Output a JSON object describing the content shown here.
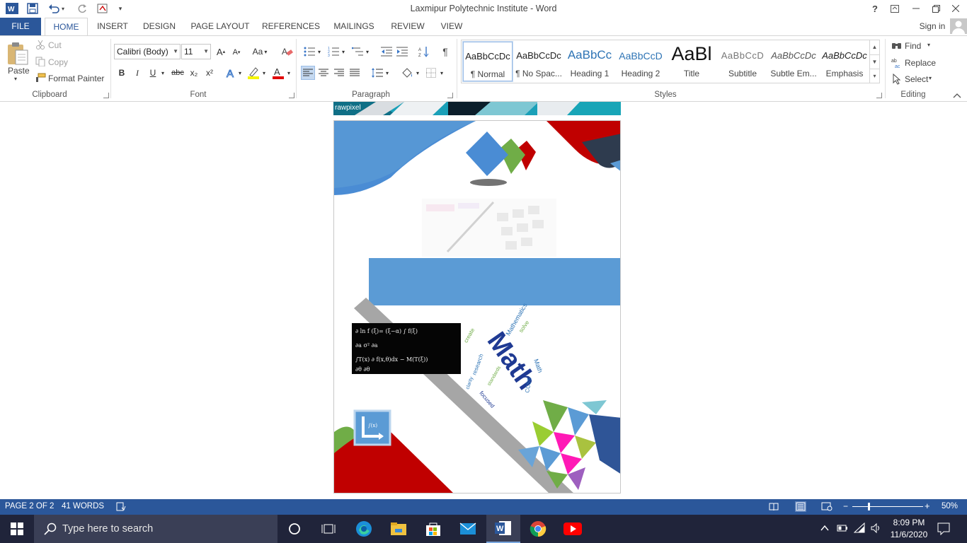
{
  "window": {
    "title": "Laxmipur Polytechnic Institute - Word"
  },
  "tabs": [
    {
      "label": "FILE"
    },
    {
      "label": "HOME"
    },
    {
      "label": "INSERT"
    },
    {
      "label": "DESIGN"
    },
    {
      "label": "PAGE LAYOUT"
    },
    {
      "label": "REFERENCES"
    },
    {
      "label": "MAILINGS"
    },
    {
      "label": "REVIEW"
    },
    {
      "label": "VIEW"
    }
  ],
  "account": {
    "signin": "Sign in"
  },
  "clipboard": {
    "paste": "Paste",
    "cut": "Cut",
    "copy": "Copy",
    "format_painter": "Format Painter",
    "label": "Clipboard"
  },
  "font": {
    "name": "Calibri (Body)",
    "size": "11",
    "label": "Font",
    "bold": "B",
    "italic": "I",
    "underline": "U",
    "strike": "abc",
    "sub": "x₂",
    "sup": "x²",
    "grow": "A",
    "shrink": "A",
    "case": "Aa"
  },
  "paragraph": {
    "label": "Paragraph"
  },
  "styles": {
    "label": "Styles",
    "items": [
      {
        "preview": "AaBbCcDc",
        "name": "¶ Normal"
      },
      {
        "preview": "AaBbCcDc",
        "name": "¶ No Spac..."
      },
      {
        "preview": "AaBbCc",
        "name": "Heading 1"
      },
      {
        "preview": "AaBbCcD",
        "name": "Heading 2"
      },
      {
        "preview": "AaBl",
        "name": "Title"
      },
      {
        "preview": "AaBbCcD",
        "name": "Subtitle"
      },
      {
        "preview": "AaBbCcDc",
        "name": "Subtle Em..."
      },
      {
        "preview": "AaBbCcDc",
        "name": "Emphasis"
      }
    ]
  },
  "editing": {
    "find": "Find",
    "replace": "Replace",
    "select": "Select",
    "label": "Editing"
  },
  "document": {
    "page1_watermark": "rawpixel",
    "wordcloud_main": "Math",
    "wordcloud_words": [
      "create",
      "solve",
      "Mathematics",
      "research",
      "focused",
      "clarity",
      "standards",
      "Math",
      "CCSS",
      "study",
      "problem"
    ]
  },
  "status": {
    "page": "PAGE 2 OF 2",
    "words": "41 WORDS",
    "zoom": "50%",
    "zoom_level_percent": 50
  },
  "taskbar": {
    "search_placeholder": "Type here to search",
    "time": "8:09 PM",
    "date": "11/6/2020"
  },
  "colors": {
    "word_blue": "#2b579a",
    "taskbar": "#20243a",
    "banner_blue": "#5b9bd5"
  }
}
